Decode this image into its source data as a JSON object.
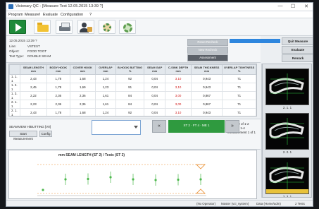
{
  "window": {
    "title": "Visionary QC - [Measure Test 12.05.2015 13:39 ?]",
    "minimize": "—",
    "maximize": "☐",
    "close": "✕"
  },
  "menu": [
    "Program",
    "Measure!",
    "Evaluate",
    "Configuration",
    "?"
  ],
  "toolbar": [
    "play-icon",
    "folder-icon",
    "printer-icon",
    "user-icon",
    "gear-icon",
    "settings-icon"
  ],
  "info": {
    "date": "12.05.2015 13:39 ?",
    "line_label": "Line:",
    "line": "VSTEST",
    "object_label": "Object:",
    "object": "FOOD TOOT",
    "test_type_label": "Test Type:",
    "test_type": "DOUBLE SEAM",
    "btn_reset": "Reset Recheck",
    "btn_new": "New Recheck",
    "btn_assessment": "Assessment",
    "btn_quit": "Quit Measure",
    "btn_evaluate": "Evaluate",
    "btn_remark": "Remark"
  },
  "table": {
    "headers": [
      "",
      "SEAM LENGTH mm",
      "BODY HOOK mm",
      "COVER HOOK mm",
      "OVERLAP mm",
      "B-HOOK BUTTING %",
      "SEAM GAP mm",
      "C-SINK DEPTH mm",
      "SEAM THICKNESS mm",
      "OVERLAP TIGHTNESS %"
    ],
    "rows": [
      [
        "1. 1. 1",
        "2,43",
        "1,78",
        "1,68",
        "1,24",
        "92",
        "0,04",
        "3,10",
        "0,943",
        "71"
      ],
      [
        "1. 2. 1",
        "2,45",
        "1,78",
        "1,69",
        "1,23",
        "91",
        "0,04",
        "3,10",
        "0,943",
        "71"
      ],
      [
        "1. 3. 1",
        "2,22",
        "2,36",
        "2,36",
        "1,61",
        "84",
        "0,04",
        "3,00",
        "0,867",
        "71"
      ],
      [
        "2. 1. 1",
        "2,23",
        "2,36",
        "2,36",
        "1,61",
        "84",
        "0,04",
        "3,00",
        "0,867",
        "71"
      ],
      [
        "2. 1. 1",
        "2,43",
        "1,78",
        "1,68",
        "1,24",
        "92",
        "0,04",
        "3,10",
        "0,943",
        "71"
      ],
      [
        "2. 2. 1",
        "2,45",
        "1,78",
        "1,69",
        "1,23",
        "91",
        "0,04",
        "3,10",
        "0,943",
        "71"
      ],
      [
        "2. 3. 1",
        "2,22",
        "2,36",
        "2,36",
        "1,61",
        "84",
        "0,04",
        "3,00",
        "0,867",
        "71"
      ],
      [
        "2. 4. 1",
        "2,23",
        "2,36",
        "2,36",
        "1,61",
        "84",
        "0,04",
        "3,00",
        "0,867",
        "71"
      ]
    ],
    "selected_row": 7
  },
  "controls": {
    "seamview_label": "SEAMVIEW H/BUTTING [V0]",
    "start": "Start Measurement",
    "config": "Config",
    "prev": "«",
    "next": "»",
    "station": "ST 2 · FT 4 · ME 1",
    "status_station": "Station 2 of 1-2",
    "status_part": "Part 4 of 1-4",
    "status_measurement": "Measurement 1 of 1"
  },
  "chart_data": {
    "type": "scatter",
    "title": "mm SEAM LENGTH (ST 2) / Tests (ST 2)",
    "xlabel": "",
    "ylabel": "",
    "ylim": [
      0,
      5
    ],
    "series": [
      {
        "name": "",
        "x": [
          1,
          2,
          3,
          4,
          5,
          6,
          7,
          8
        ],
        "y": [
          0.8,
          2.3,
          2.35,
          2.6,
          2.3,
          2.2,
          2.25,
          2.3
        ]
      }
    ],
    "limits": {
      "upper": 4.4,
      "lower": 0.3
    }
  },
  "thumbs": [
    {
      "label": "2. 1. 1"
    },
    {
      "label": "2. 2. 1"
    },
    {
      "label": "2. 3. 1"
    }
  ],
  "status": {
    "operator": "(No Operator)",
    "master": "Master (vci_system)",
    "data": "Data (Home/adm)",
    "tests": "2 Tests"
  },
  "colors": {
    "accent_blue": "#2e86de",
    "station_green": "#2f9a3f",
    "limit_orange": "#e98b2a",
    "series_green": "#4db84d"
  }
}
